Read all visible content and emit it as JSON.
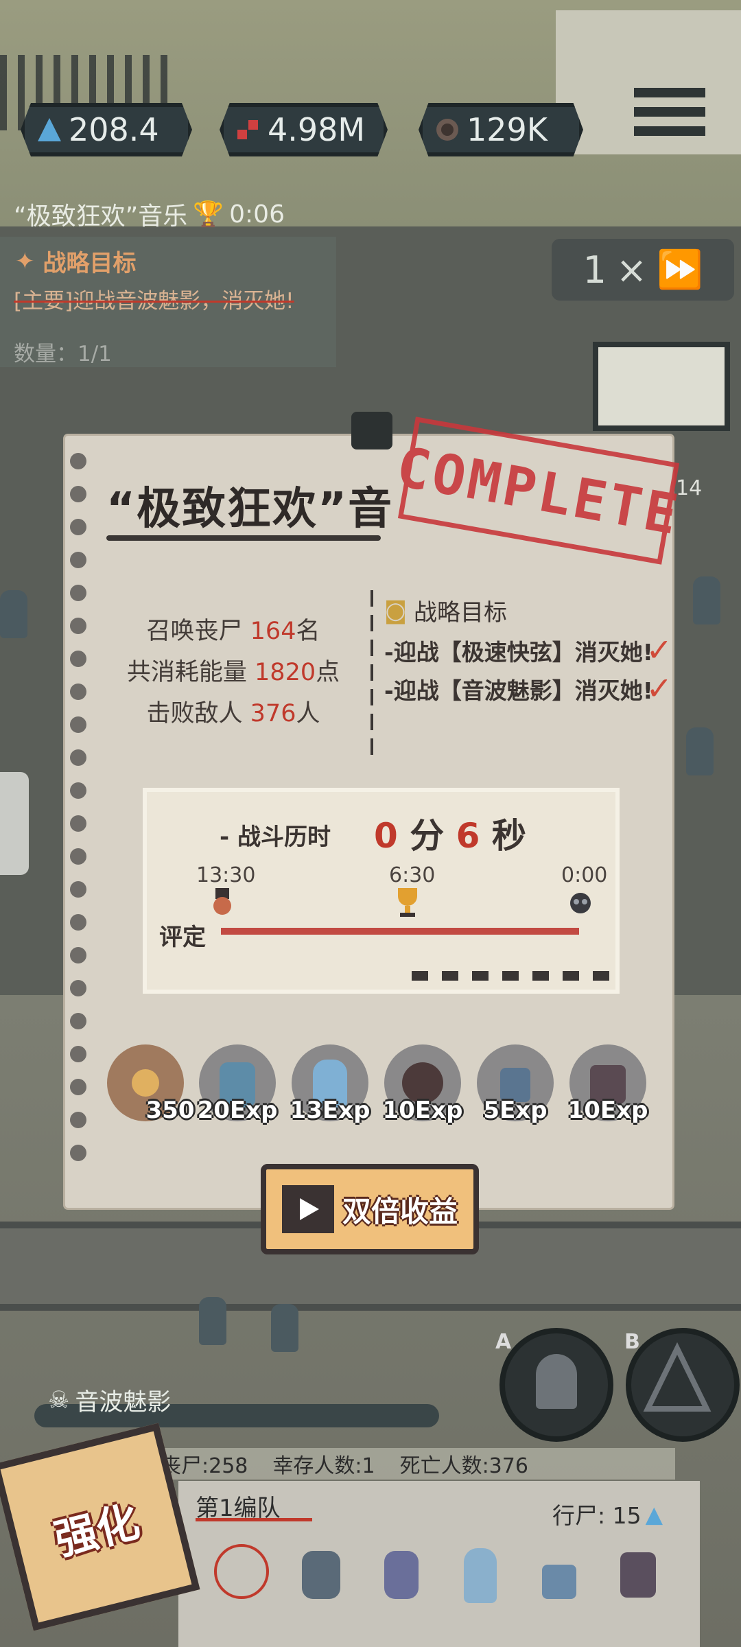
{
  "resources": [
    {
      "icon": "energy-triangle-icon",
      "value": "208.4"
    },
    {
      "icon": "blood-cells-icon",
      "value": "4.98M"
    },
    {
      "icon": "brain-icon",
      "value": "129K"
    }
  ],
  "track": {
    "name": "“极致狂欢”音乐",
    "time": "0:06"
  },
  "objective_panel": {
    "title": "战略目标",
    "line": "[主要]迎战音波魅影，消灭她!",
    "count": "数量：1/1"
  },
  "speed": {
    "multiplier": "1",
    "unit": "×"
  },
  "side_count": "14",
  "result": {
    "title": "“极致狂欢”音",
    "stamp": "COMPLETE",
    "stats": [
      {
        "pre": "召唤丧尸",
        "value": "164",
        "post": "名"
      },
      {
        "pre": "共消耗能量",
        "value": "1820",
        "post": "点"
      },
      {
        "pre": "击败敌人",
        "value": "376",
        "post": "人"
      }
    ],
    "goals_title": "战略目标",
    "goals": [
      {
        "text": "-迎战【极速快弦】消灭她!",
        "done": "✓"
      },
      {
        "text": "-迎战【音波魅影】消灭她!",
        "done": "✓"
      }
    ],
    "timer": {
      "label": "- 战斗历时",
      "min": "0",
      "min_unit": "分",
      "sec": "6",
      "sec_unit": "秒"
    },
    "timeline_ticks": [
      "13:30",
      "6:30",
      "0:00"
    ],
    "rating_label": "评定",
    "rewards": [
      {
        "kind": "coin",
        "label": "350"
      },
      {
        "kind": "zombie",
        "label": "20Exp"
      },
      {
        "kind": "zombie",
        "label": "13Exp"
      },
      {
        "kind": "zombie",
        "label": "10Exp"
      },
      {
        "kind": "zombie",
        "label": "5Exp"
      },
      {
        "kind": "zombie",
        "label": "10Exp"
      }
    ],
    "double_button": "双倍收益"
  },
  "boss": {
    "name": "音波魅影"
  },
  "skills": [
    {
      "key": "A"
    },
    {
      "key": "B"
    }
  ],
  "counts": {
    "zombies": "丧尸:258",
    "survivors": "幸存人数:1",
    "dead": "死亡人数:376"
  },
  "squad": {
    "name": "第1编队",
    "walkers": "行尸: 15"
  },
  "upgrade_label": "强化",
  "colors": {
    "accent_red": "#c0392b",
    "card": "#d8d2c6",
    "button": "#f0c07c"
  }
}
